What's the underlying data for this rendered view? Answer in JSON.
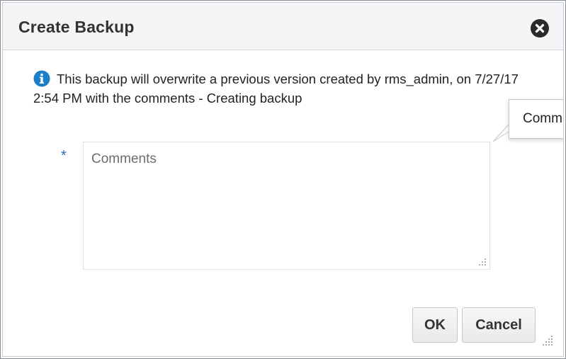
{
  "dialog": {
    "title": "Create Backup",
    "close_icon": "close-icon"
  },
  "info": {
    "icon": "info-icon",
    "message": "This backup will overwrite a previous version created by rms_admin, on 7/27/17 2:54 PM with the comments - Creating backup"
  },
  "form": {
    "required_marker": "*",
    "comments_placeholder": "Comments",
    "comments_value": ""
  },
  "tooltip": {
    "text": "Comm"
  },
  "buttons": {
    "ok_label": "OK",
    "cancel_label": "Cancel"
  },
  "colors": {
    "info_blue": "#1a7ec8",
    "required_blue": "#2f6ab3",
    "header_bg": "#f4f5f6"
  }
}
